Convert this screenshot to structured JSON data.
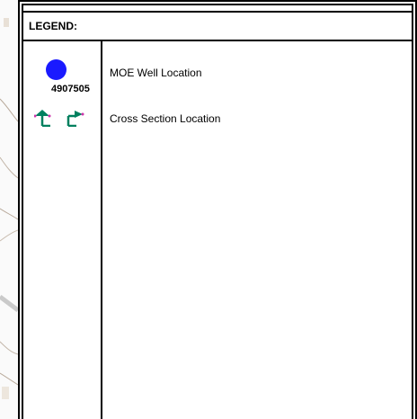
{
  "legend": {
    "title": "LEGEND:",
    "items": [
      {
        "symbol_label": "4907505",
        "label": "MOE Well Location",
        "symbol_color": "#1a1aff",
        "icon": "well-location-icon"
      },
      {
        "label": "Cross Section Location",
        "symbol_color": "#00805f",
        "icon": "cross-section-icon"
      }
    ]
  }
}
